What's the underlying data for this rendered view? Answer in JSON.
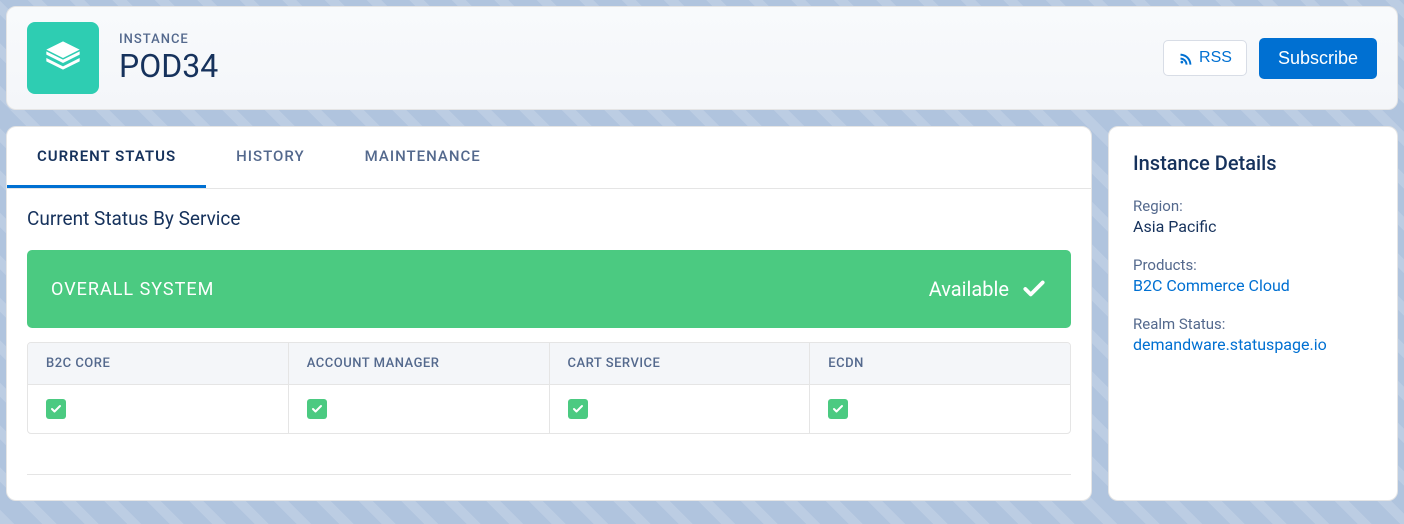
{
  "header": {
    "eyebrow": "INSTANCE",
    "name": "POD34",
    "rss_label": "RSS",
    "subscribe_label": "Subscribe"
  },
  "tabs": {
    "current": "CURRENT STATUS",
    "history": "HISTORY",
    "maintenance": "MAINTENANCE"
  },
  "main": {
    "section_title": "Current Status By Service",
    "overall_label": "OVERALL SYSTEM",
    "overall_status": "Available",
    "services": [
      {
        "name": "B2C CORE",
        "status": "ok"
      },
      {
        "name": "ACCOUNT MANAGER",
        "status": "ok"
      },
      {
        "name": "CART SERVICE",
        "status": "ok"
      },
      {
        "name": "ECDN",
        "status": "ok"
      }
    ]
  },
  "sidebar": {
    "title": "Instance Details",
    "region_label": "Region:",
    "region_value": "Asia Pacific",
    "products_label": "Products:",
    "products_link": "B2C Commerce Cloud",
    "realm_label": "Realm Status:",
    "realm_link": "demandware.statuspage.io"
  }
}
